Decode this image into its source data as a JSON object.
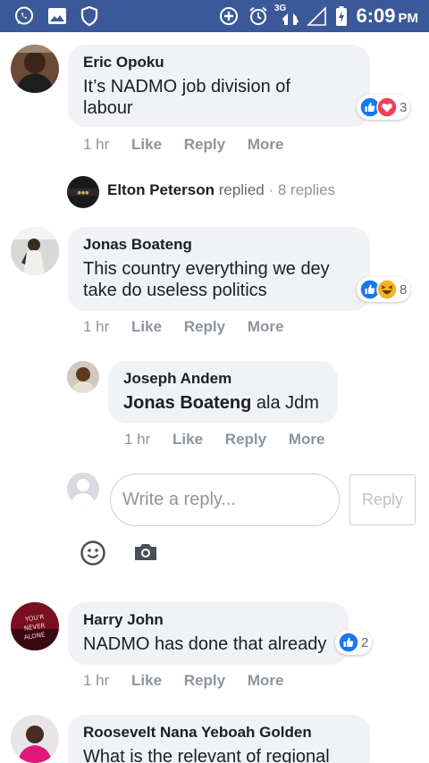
{
  "status_bar": {
    "time": "6:09",
    "ampm": "PM",
    "network": "3G",
    "icons": [
      "whatsapp-icon",
      "gallery-icon",
      "shield-icon",
      "add-circle-icon",
      "alarm-icon",
      "signal-icon",
      "battery-charging-icon"
    ]
  },
  "colors": {
    "status_bar": "#3b5998",
    "bubble": "#f0f2f5",
    "muted": "#8d949e",
    "like_blue": "#1877f2",
    "love_red": "#f33e58",
    "haha_yellow": "#f7b125"
  },
  "comments": [
    {
      "author": "Eric Opoku",
      "text": "It’s NADMO job division of labour",
      "reactions": [
        "like-reaction-icon",
        "love-reaction-icon"
      ],
      "reaction_count": "3",
      "time": "1 hr",
      "like": "Like",
      "reply": "Reply",
      "more": "More"
    },
    {
      "author": "Jonas Boateng",
      "text": "This country everything we dey take do useless politics",
      "reactions": [
        "like-reaction-icon",
        "haha-reaction-icon"
      ],
      "reaction_count": "8",
      "time": "1 hr",
      "like": "Like",
      "reply": "Reply",
      "more": "More"
    },
    {
      "author": "Harry John",
      "text": "NADMO has done that already",
      "reactions": [
        "like-reaction-icon"
      ],
      "reaction_count": "2",
      "time": "1 hr",
      "like": "Like",
      "reply": "Reply",
      "more": "More"
    },
    {
      "author": "Roosevelt Nana Yeboah Golden",
      "text": "What is the relevant of regional"
    }
  ],
  "replied_summary": {
    "name": "Elton Peterson",
    "verb": "replied",
    "count": "· 8 replies"
  },
  "nested_reply": {
    "author": "Joseph Andem",
    "mention": "Jonas Boateng",
    "text": "ala Jdm",
    "time": "1 hr",
    "like": "Like",
    "reply": "Reply",
    "more": "More"
  },
  "composer": {
    "placeholder": "Write a reply...",
    "button": "Reply",
    "tools": [
      "emoji-icon",
      "camera-icon"
    ]
  }
}
